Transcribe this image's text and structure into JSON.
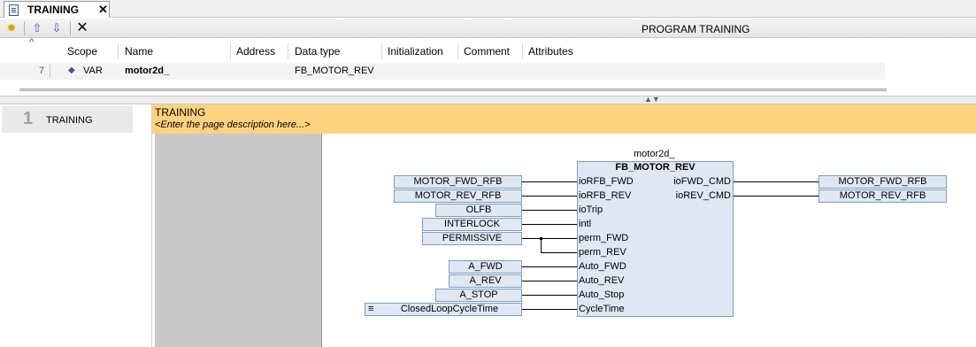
{
  "tab": {
    "label": "TRAINING"
  },
  "toolbar": {
    "program_title": "PROGRAM TRAINING"
  },
  "variables": {
    "columns": [
      "Scope",
      "Name",
      "Address",
      "Data type",
      "Initialization",
      "Comment",
      "Attributes"
    ],
    "rows": [
      {
        "line": "7",
        "scope": "VAR",
        "name": "motor2d_",
        "address": "",
        "data_type": "FB_MOTOR_REV",
        "initialization": "",
        "comment": "",
        "attributes": ""
      }
    ]
  },
  "network": {
    "number": "1",
    "name": "TRAINING",
    "page_title": "TRAINING",
    "page_description": "<Enter the page description here...>"
  },
  "fb": {
    "instance": "motor2d_",
    "type": "FB_MOTOR_REV",
    "inputs": [
      "ioRFB_FWD",
      "ioRFB_REV",
      "ioTrip",
      "intl",
      "perm_FWD",
      "perm_REV",
      "Auto_FWD",
      "Auto_REV",
      "Auto_Stop",
      "CycleTime"
    ],
    "outputs": [
      "ioFWD_CMD",
      "ioREV_CMD"
    ]
  },
  "input_vars": [
    "MOTOR_FWD_RFB",
    "MOTOR_REV_RFB",
    "OLFB",
    "INTERLOCK",
    "PERMISSIVE",
    "A_FWD",
    "A_REV",
    "A_STOP",
    "ClosedLoopCycleTime"
  ],
  "output_vars": [
    "MOTOR_FWD_RFB",
    "MOTOR_REV_RFB"
  ],
  "icons": {
    "tab": "document-icon",
    "add": "add-variable-icon",
    "up": "move-up-icon",
    "down": "move-down-icon",
    "delete": "delete-icon",
    "const": "constant-icon"
  }
}
